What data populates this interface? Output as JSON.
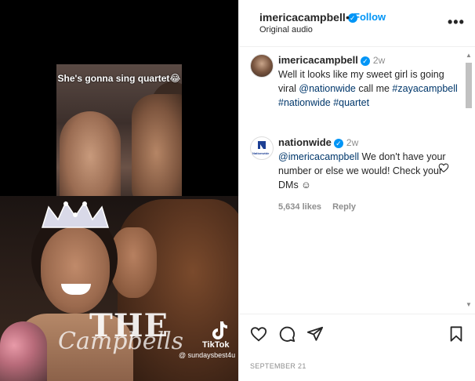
{
  "media": {
    "inset_caption": "She's gonna sing quartet😂",
    "overlay_big": "THE",
    "overlay_script": "Campbells",
    "tiktok_word": "TikTok",
    "tiktok_user": "@ sundaysbest4u"
  },
  "header": {
    "username": "imericacampbell",
    "dot": "•",
    "follow_label": "Follow",
    "audio": "Original audio",
    "more_icon": "more-horizontal-icon"
  },
  "comments": [
    {
      "username": "imericacampbell",
      "time": "2w",
      "text_pre": "Well it looks like my sweet girl is going viral ",
      "mention": "@nationwide",
      "text_post": " call me ",
      "hashtags": "#zayacampbell #nationwide #quartet"
    },
    {
      "username": "nationwide",
      "time": "2w",
      "avatar_text": "Nationwide",
      "mention": "@imericacampbell",
      "text_post": " We don't have your number or else we would! Check your DMs ☺",
      "likes": "5,634 likes",
      "reply": "Reply"
    }
  ],
  "footer": {
    "date": "SEPTEMBER 21"
  },
  "colors": {
    "accent": "#0095f6",
    "mention": "#00376b",
    "muted": "#8e8e8e"
  }
}
